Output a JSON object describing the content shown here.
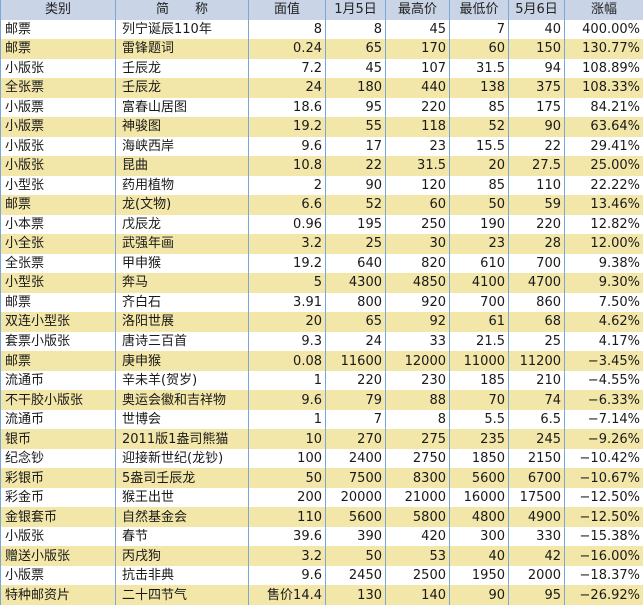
{
  "headers": [
    "类别",
    "简　　称",
    "面值",
    "1月5日",
    "最高价",
    "最低价",
    "5月6日",
    "涨幅"
  ],
  "rows": [
    [
      "邮票",
      "列宁诞辰110年",
      "8",
      "8",
      "45",
      "7",
      "40",
      "400.00%"
    ],
    [
      "邮票",
      "雷锋题词",
      "0.24",
      "65",
      "170",
      "60",
      "150",
      "130.77%"
    ],
    [
      "小版张",
      "壬辰龙",
      "7.2",
      "45",
      "107",
      "31.5",
      "94",
      "108.89%"
    ],
    [
      "全张票",
      "壬辰龙",
      "24",
      "180",
      "440",
      "138",
      "375",
      "108.33%"
    ],
    [
      "小版票",
      "富春山居图",
      "18.6",
      "95",
      "220",
      "85",
      "175",
      "84.21%"
    ],
    [
      "小版票",
      "神骏图",
      "19.2",
      "55",
      "118",
      "52",
      "90",
      "63.64%"
    ],
    [
      "小版张",
      "海峡西岸",
      "9.6",
      "17",
      "23",
      "15.5",
      "22",
      "29.41%"
    ],
    [
      "小版张",
      "昆曲",
      "10.8",
      "22",
      "31.5",
      "20",
      "27.5",
      "25.00%"
    ],
    [
      "小型张",
      "药用植物",
      "2",
      "90",
      "120",
      "85",
      "110",
      "22.22%"
    ],
    [
      "邮票",
      "龙(文物)",
      "6.6",
      "52",
      "60",
      "50",
      "59",
      "13.46%"
    ],
    [
      "小本票",
      "戊辰龙",
      "0.96",
      "195",
      "250",
      "190",
      "220",
      "12.82%"
    ],
    [
      "小全张",
      "武强年画",
      "3.2",
      "25",
      "30",
      "23",
      "28",
      "12.00%"
    ],
    [
      "全张票",
      "甲申猴",
      "19.2",
      "640",
      "820",
      "610",
      "700",
      "9.38%"
    ],
    [
      "小型张",
      "奔马",
      "5",
      "4300",
      "4850",
      "4100",
      "4700",
      "9.30%"
    ],
    [
      "邮票",
      "齐白石",
      "3.91",
      "800",
      "920",
      "700",
      "860",
      "7.50%"
    ],
    [
      "双连小型张",
      "洛阳世展",
      "20",
      "65",
      "92",
      "61",
      "68",
      "4.62%"
    ],
    [
      "套票小版张",
      "唐诗三百首",
      "9.3",
      "24",
      "33",
      "21.5",
      "25",
      "4.17%"
    ],
    [
      "邮票",
      "庚申猴",
      "0.08",
      "11600",
      "12000",
      "11000",
      "11200",
      "−3.45%"
    ],
    [
      "流通币",
      "辛未羊(贺岁)",
      "1",
      "220",
      "230",
      "185",
      "210",
      "−4.55%"
    ],
    [
      "不干胶小版张",
      "奥运会徽和吉祥物",
      "9.6",
      "79",
      "88",
      "70",
      "74",
      "−6.33%"
    ],
    [
      "流通币",
      "世博会",
      "1",
      "7",
      "8",
      "5.5",
      "6.5",
      "−7.14%"
    ],
    [
      "银币",
      "2011版1盎司熊猫",
      "10",
      "270",
      "275",
      "235",
      "245",
      "−9.26%"
    ],
    [
      "纪念钞",
      "迎接新世纪(龙钞)",
      "100",
      "2400",
      "2750",
      "1850",
      "2150",
      "−10.42%"
    ],
    [
      "彩银币",
      "5盎司壬辰龙",
      "50",
      "7500",
      "8300",
      "5600",
      "6700",
      "−10.67%"
    ],
    [
      "彩金币",
      "猴王出世",
      "200",
      "20000",
      "21000",
      "16000",
      "17500",
      "−12.50%"
    ],
    [
      "金银套币",
      "自然基金会",
      "110",
      "5600",
      "5800",
      "4800",
      "4900",
      "−12.50%"
    ],
    [
      "小版张",
      "春节",
      "39.6",
      "390",
      "420",
      "300",
      "330",
      "−15.38%"
    ],
    [
      "赠送小版张",
      "丙戌狗",
      "3.2",
      "50",
      "53",
      "40",
      "42",
      "−16.00%"
    ],
    [
      "小版票",
      "抗击非典",
      "9.6",
      "2450",
      "2500",
      "1950",
      "2000",
      "−18.37%"
    ],
    [
      "特种邮资片",
      "二十四节气",
      "售价14.4",
      "130",
      "140",
      "90",
      "95",
      "−26.92%"
    ]
  ]
}
